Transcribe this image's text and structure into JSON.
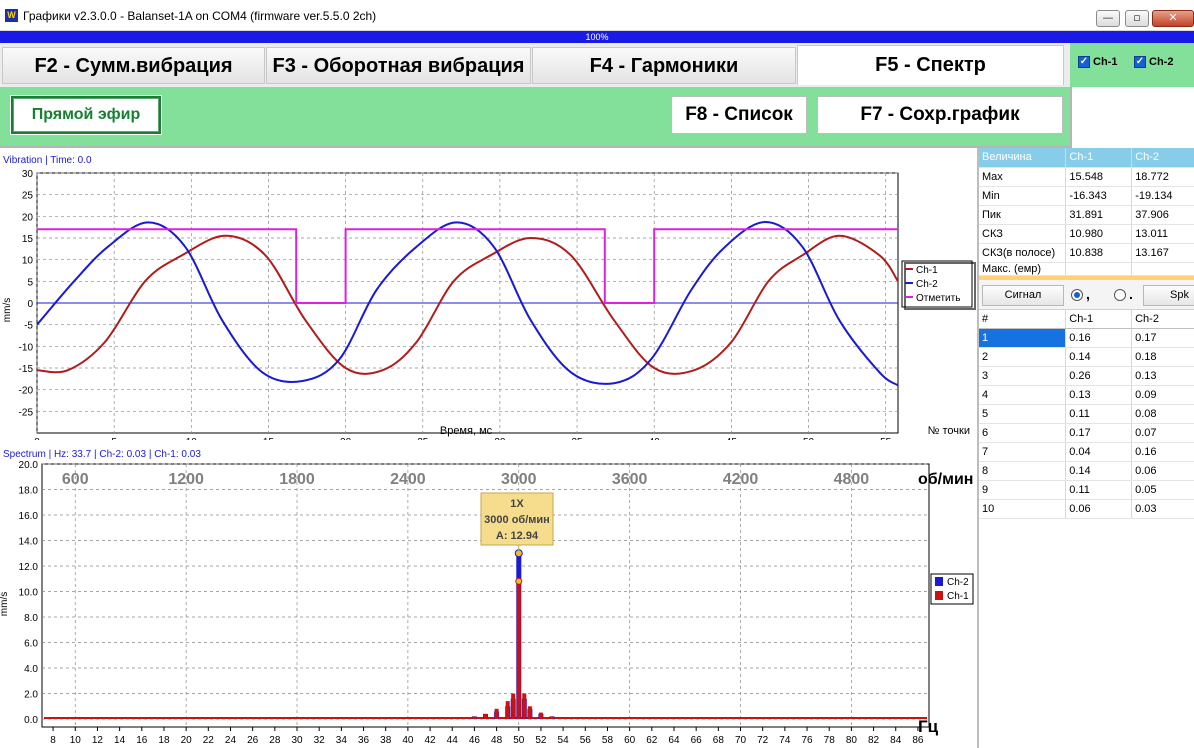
{
  "window": {
    "title": "Графики v2.3.0.0 - Balanset-1A on COM4 (firmware ver.5.5.0 2ch)",
    "icon_label": "W",
    "min_label": "—",
    "max_label": "▫",
    "close_label": "✕"
  },
  "progress": {
    "percent_text": "100%",
    "value": 100
  },
  "tabs": [
    {
      "label": "F2 - Сумм.вибрация",
      "active": false
    },
    {
      "label": "F3 - Оборотная вибрация",
      "active": false
    },
    {
      "label": "F4 - Гармоники",
      "active": false
    },
    {
      "label": "F5 - Спектр",
      "active": true
    }
  ],
  "channels": [
    {
      "label": "Ch-1",
      "checked": true
    },
    {
      "label": "Ch-2",
      "checked": true
    }
  ],
  "toolbar": {
    "live_label": "Прямой эфир",
    "list_label": "F8 - Список",
    "save_label": "F7 - Сохр.график"
  },
  "time_chart": {
    "header": "Vibration | Time: 0.0",
    "ylabel": "mm/s",
    "xlabel": "Время, мс",
    "corner_label": "№ точки",
    "y_ticks": [
      "30",
      "25",
      "20",
      "15",
      "10",
      "5",
      "0",
      "-5",
      "-10",
      "-15",
      "-20",
      "-25"
    ],
    "x_ticks": [
      "0",
      "5",
      "10",
      "15",
      "20",
      "25",
      "30",
      "35",
      "40",
      "45",
      "50",
      "55"
    ],
    "legend": [
      "Ch-1",
      "Ch-2",
      "Отметить"
    ]
  },
  "spectrum_chart": {
    "header": "Spectrum | Hz: 33.7 | Ch-2: 0.03 | Ch-1: 0.03",
    "ylabel": "mm/s",
    "y_ticks": [
      "20.0",
      "18.0",
      "16.0",
      "14.0",
      "12.0",
      "10.0",
      "8.0",
      "6.0",
      "4.0",
      "2.0",
      "0.0"
    ],
    "rpm_ticks": [
      "600",
      "1200",
      "1800",
      "2400",
      "3000",
      "3600",
      "4200",
      "4800"
    ],
    "rpm_unit": "об/мин",
    "hz_unit": "Гц",
    "x_ticks": [
      "8",
      "10",
      "12",
      "14",
      "16",
      "18",
      "20",
      "22",
      "24",
      "26",
      "28",
      "30",
      "32",
      "34",
      "36",
      "38",
      "40",
      "42",
      "44",
      "46",
      "48",
      "50",
      "52",
      "54",
      "56",
      "58",
      "60",
      "62",
      "64",
      "66",
      "68",
      "70",
      "72",
      "74",
      "76",
      "78",
      "80",
      "82",
      "84",
      "86"
    ],
    "legend": [
      "Ch-2",
      "Ch-1"
    ],
    "peak_box": {
      "line1": "1X",
      "line2": "3000 об/мин",
      "line3": "A: 12.94"
    }
  },
  "chart_data": [
    {
      "type": "line",
      "xlabel": "Время, мс",
      "ylabel": "mm/s",
      "xlim": [
        0,
        55.8
      ],
      "ylim": [
        -30,
        30
      ],
      "series": [
        {
          "name": "Ch-1",
          "color": "#b01c1c",
          "x": [
            0,
            2,
            4.4,
            7,
            9.4,
            12.2,
            14.8,
            17.4,
            20,
            22.4,
            24.6,
            27,
            29.4,
            32,
            34.6,
            37.4,
            40,
            42.6,
            45,
            47.4,
            49.6,
            52,
            54.6,
            55.8
          ],
          "y": [
            -15.5,
            -15.5,
            -9,
            5,
            11,
            15.5,
            11,
            -4,
            -15,
            -15.5,
            -9,
            5,
            11,
            15,
            11,
            -4,
            -15,
            -15.5,
            -9,
            5,
            11,
            15.5,
            11,
            5
          ]
        },
        {
          "name": "Ch-2",
          "color": "#1a1ad4",
          "x": [
            0,
            2.4,
            4.6,
            7.2,
            9.6,
            12,
            14.6,
            17.2,
            19.6,
            22,
            24.6,
            27.2,
            29.6,
            32,
            34.6,
            37.4,
            39.8,
            42.4,
            44.6,
            47.2,
            49.6,
            52,
            54.6,
            55.8
          ],
          "y": [
            -5,
            5,
            13,
            18.6,
            13,
            -4,
            -16,
            -18,
            -13,
            3,
            13,
            18.6,
            13,
            -4,
            -16,
            -18.5,
            -13,
            3,
            13,
            18.7,
            13,
            -4,
            -16,
            -19
          ]
        },
        {
          "name": "Отметить",
          "color": "#e020e0",
          "x": [
            0,
            16.8,
            16.8,
            20,
            20,
            36.8,
            36.8,
            40,
            40,
            55.8
          ],
          "y": [
            17,
            17,
            0,
            0,
            17,
            17,
            0,
            0,
            17,
            17
          ]
        }
      ]
    },
    {
      "type": "bar",
      "xlabel": "Гц",
      "ylabel": "mm/s",
      "xlim": [
        7,
        87
      ],
      "ylim": [
        0,
        20
      ],
      "series": [
        {
          "name": "Ch-2",
          "color": "#1a1ad4",
          "x": [
            46,
            47,
            48,
            49,
            49.5,
            50,
            50.5,
            51,
            52,
            53
          ],
          "values": [
            0.2,
            0.4,
            0.6,
            1.0,
            1.6,
            13.0,
            1.6,
            0.8,
            0.4,
            0.2
          ]
        },
        {
          "name": "Ch-1",
          "color": "#cc1111",
          "x": [
            46,
            47,
            48,
            49,
            49.5,
            50,
            50.5,
            51,
            52,
            53
          ],
          "values": [
            0.2,
            0.4,
            0.8,
            1.4,
            2.0,
            10.8,
            2.0,
            1.0,
            0.5,
            0.2
          ]
        }
      ],
      "annotation": {
        "x": 50,
        "text": [
          "1X",
          "3000 об/мин",
          "A: 12.94"
        ]
      }
    }
  ],
  "stats_table": {
    "headers": [
      "Величина",
      "Ch-1",
      "Ch-2"
    ],
    "rows": [
      [
        "Max",
        "15.548",
        "18.772"
      ],
      [
        "Min",
        "-16.343",
        "-19.134"
      ],
      [
        "Пик",
        "31.891",
        "37.906"
      ],
      [
        "СКЗ",
        "10.980",
        "13.011"
      ],
      [
        "СКЗ(в полосе)",
        "10.838",
        "13.167"
      ],
      [
        "Макс. (емр)",
        "",
        ""
      ]
    ]
  },
  "signal_controls": {
    "signal_label": "Сигнал",
    "radio1_label": ",",
    "radio2_label": ".",
    "spk_label": "Spk"
  },
  "harmonics_table": {
    "headers": [
      "#",
      "Ch-1",
      "Ch-2"
    ],
    "rows": [
      [
        "1",
        "0.16",
        "0.17"
      ],
      [
        "2",
        "0.14",
        "0.18"
      ],
      [
        "3",
        "0.26",
        "0.13"
      ],
      [
        "4",
        "0.13",
        "0.09"
      ],
      [
        "5",
        "0.11",
        "0.08"
      ],
      [
        "6",
        "0.17",
        "0.07"
      ],
      [
        "7",
        "0.04",
        "0.16"
      ],
      [
        "8",
        "0.14",
        "0.06"
      ],
      [
        "9",
        "0.11",
        "0.05"
      ],
      [
        "10",
        "0.06",
        "0.03"
      ]
    ]
  }
}
